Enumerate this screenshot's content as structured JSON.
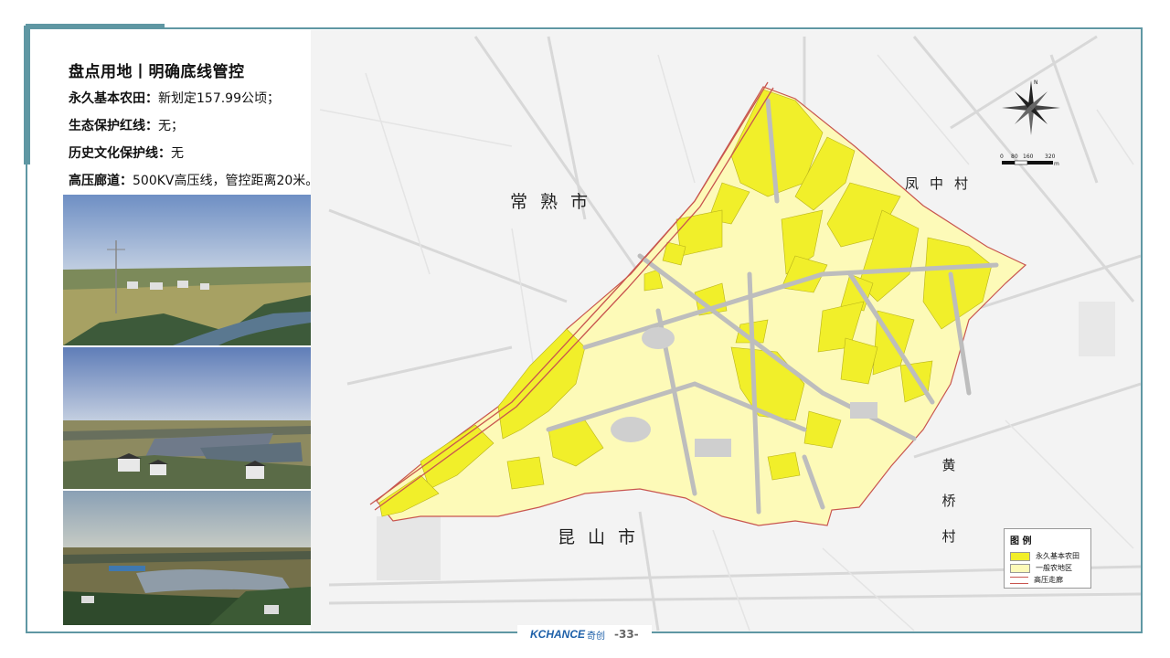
{
  "header": {
    "title": "盘点用地丨明确底线管控",
    "lines": [
      {
        "label": "永久基本农田：",
        "value": "新划定157.99公顷；"
      },
      {
        "label": "生态保护红线：",
        "value": "无；"
      },
      {
        "label": "历史文化保护线：",
        "value": "无"
      },
      {
        "label": "高压廊道：",
        "value": "500KV高压线，管控距离20米。"
      }
    ]
  },
  "map": {
    "places": {
      "changshu": "常熟市",
      "kunshan": "昆山市",
      "fengzhong": "凤中村",
      "huangqiao": [
        "黄",
        "桥",
        "村"
      ]
    },
    "scale_labels": [
      "0",
      "80",
      "160",
      "320"
    ],
    "scale_unit": "m",
    "north_label": "N"
  },
  "legend": {
    "title": "图 例",
    "items": [
      {
        "label": "永久基本农田",
        "color": "#f1ef2a"
      },
      {
        "label": "一般农地区",
        "color": "#fdfab8"
      },
      {
        "label": "高压走廊",
        "color": "#c8554f"
      }
    ]
  },
  "footer": {
    "brand": "KCHANCE",
    "brand_cn": "奇创",
    "page": "-33-"
  }
}
